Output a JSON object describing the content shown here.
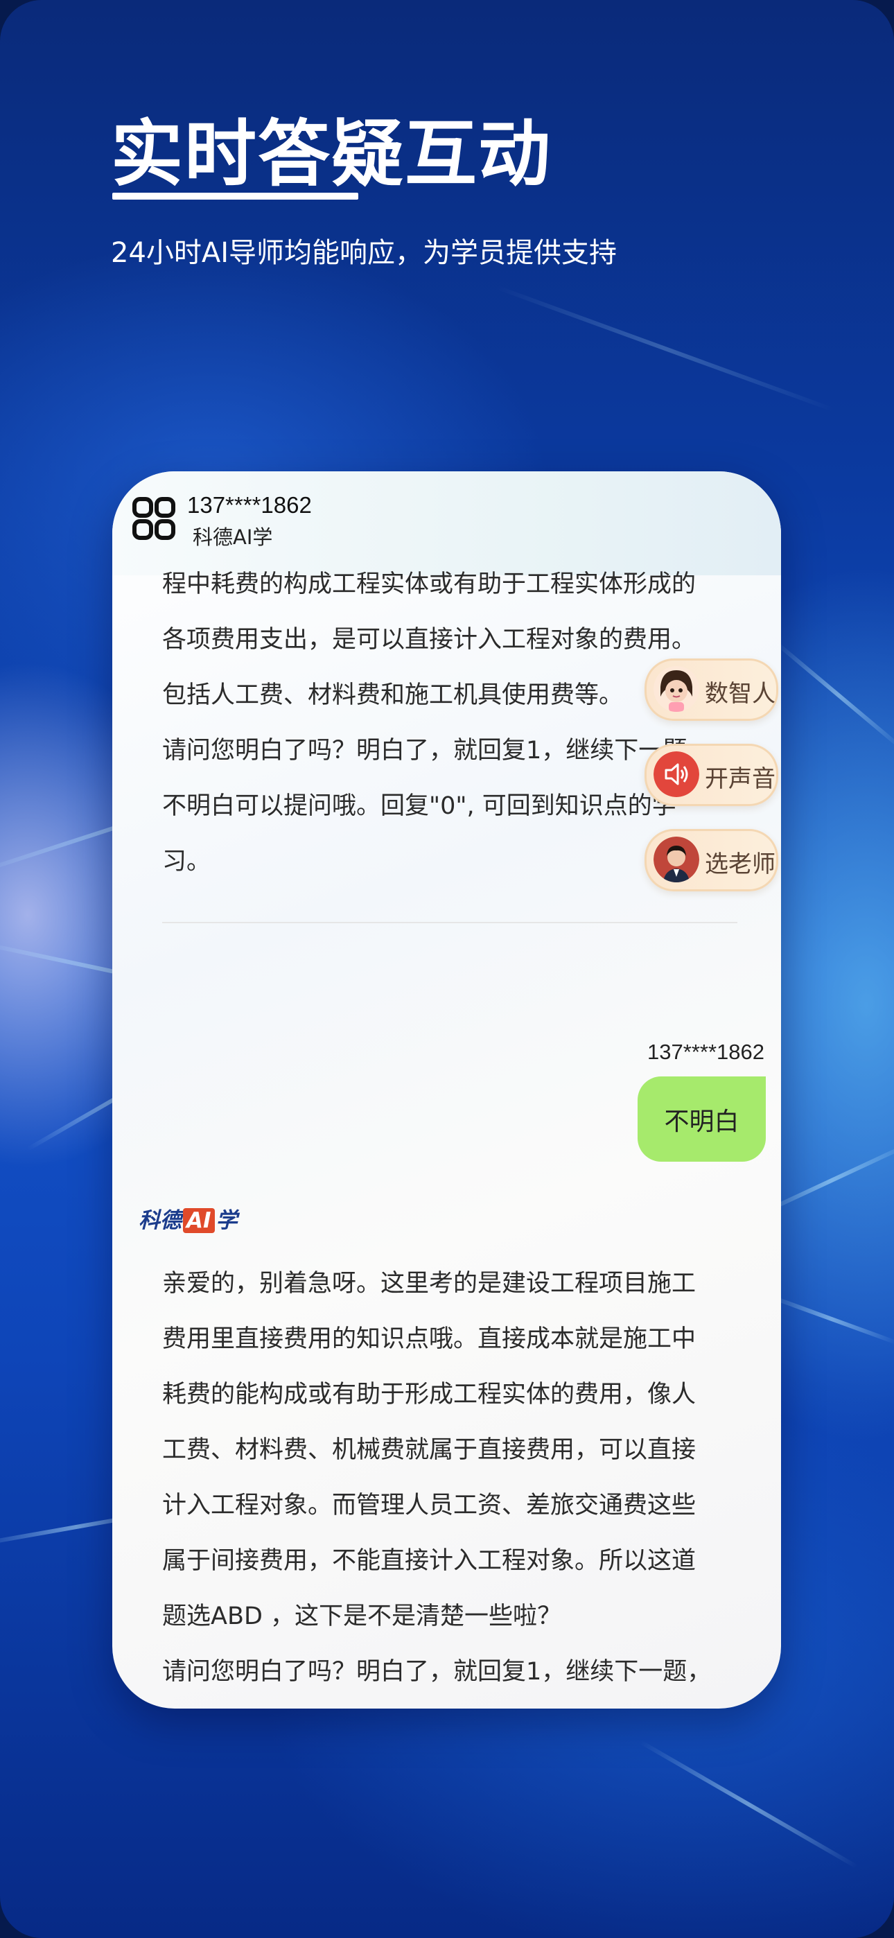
{
  "hero": {
    "title": "实时答疑互动",
    "subtitle": "24小时AI导师均能响应，为学员提供支持"
  },
  "app": {
    "phone": "137****1862",
    "name": "科德AI学",
    "logo_icon": "app-logo-icon"
  },
  "chat": {
    "ai_message_1_lines": [
      "程中耗费的构成工程实体或有助于工程实体形成的",
      "各项费用支出，是可以直接计入工程对象的费用。",
      "包括人工费、材料费和施工机具使用费等。",
      "请问您明白了吗？明白了，就回复1，继续下一题，",
      "不明白可以提问哦。回复\"0\", 可回到知识点的学",
      "习。"
    ],
    "user_name": "137****1862",
    "user_message": "不明白",
    "brand": {
      "part1": "科德",
      "part2": "AI",
      "part3": "学"
    },
    "ai_message_2_lines": [
      "亲爱的，别着急呀。这里考的是建设工程项目施工",
      "费用里直接费用的知识点哦。直接成本就是施工中",
      "耗费的能构成或有助于形成工程实体的费用，像人",
      "工费、材料费、机械费就属于直接费用，可以直接",
      "计入工程对象。而管理人员工资、差旅交通费这些",
      "属于间接费用，不能直接计入工程对象。所以这道",
      "题选ABD ，这下是不是清楚一些啦？",
      "请问您明白了吗？明白了，就回复1，继续下一题，"
    ]
  },
  "chips": [
    {
      "label": "数智人",
      "icon": "digital-human-avatar-icon"
    },
    {
      "label": "开声音",
      "icon": "speaker-icon"
    },
    {
      "label": "选老师",
      "icon": "teacher-avatar-icon"
    }
  ],
  "colors": {
    "user_bubble": "#a6ea6c",
    "brand_blue": "#1b3c8c",
    "brand_red": "#e04a2a",
    "chip_bg": "#fbe6cf"
  }
}
